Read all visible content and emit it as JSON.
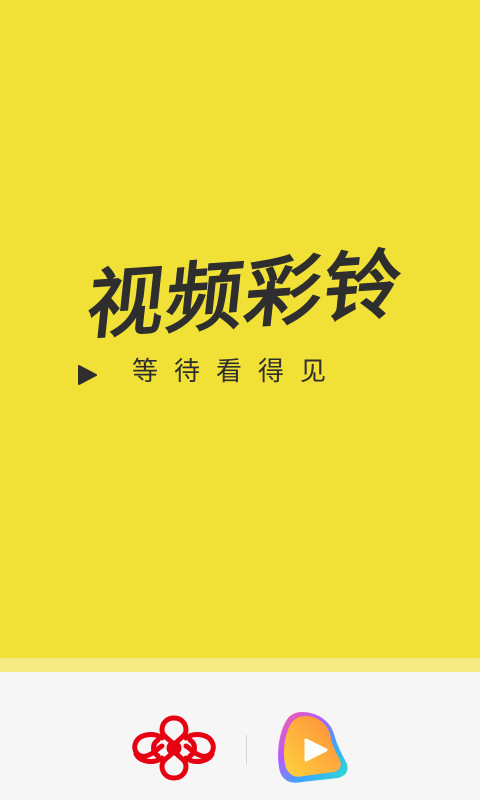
{
  "splash": {
    "title": "视频彩铃",
    "tagline": "等待看得见",
    "icons": {
      "tagline_icon": "play-icon",
      "carrier_logo": "china-unicom-logo",
      "app_logo": "video-ringtone-app-logo"
    },
    "colors": {
      "background": "#F1E035",
      "text": "#2E2E2E",
      "footer_background": "#F6F6F6",
      "carrier_logo_red": "#E60012"
    }
  }
}
